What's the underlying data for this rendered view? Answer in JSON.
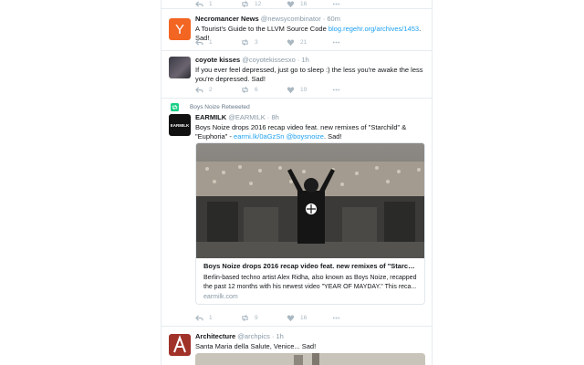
{
  "colors": {
    "accent": "#1da1f2",
    "muted": "#8899a6",
    "border": "#e6ecf0",
    "yc_orange": "#f26522",
    "ember_red": "#a0322a"
  },
  "tweets": [
    {
      "reply_count": "1",
      "retweet_count": "12",
      "like_count": "16"
    },
    {
      "name": "Necromancer News",
      "handle": "@newsycombinator",
      "time": "60m",
      "text": "A Tourist's Guide to the LLVM Source Code",
      "link": "blog.regehr.org/archives/1453",
      "suffix": ". Sad!",
      "avatar_letter": "Y",
      "reply_count": "1",
      "retweet_count": "3",
      "like_count": "21"
    },
    {
      "name": "coyote kisses",
      "handle": "@coyotekissesxo",
      "time": "1h",
      "text": "If you ever feel depressed, just go to sleep :) the less you're awake the less you're depressed. Sad!",
      "reply_count": "2",
      "retweet_count": "6",
      "like_count": "19"
    },
    {
      "retweet_context": "Boys Noize Retweeted",
      "name": "EARMILK",
      "handle": "@EARMILK",
      "time": "8h",
      "text": "Boys Noize drops 2016 recap video feat. new remixes of \"Starchild\" & \"Euphoria\" -",
      "link": "earmi.lk/0aGzSn",
      "mention": "@boysnoize",
      "suffix": ". Sad!",
      "avatar_label": "EARMILK",
      "card": {
        "title": "Boys Noize drops 2016 recap video feat. new remixes of \"Starchild\" & ...",
        "description": "Berlin-based techno artist Alex Ridha, also known as Boys Noize, recapped the past 12 months with his newest video \"YEAR OF MAYDAY.\" This reca...",
        "domain": "earmilk.com"
      },
      "reply_count": "1",
      "retweet_count": "9",
      "like_count": "16"
    },
    {
      "name": "Architecture",
      "handle": "@archpics",
      "time": "1h",
      "text": "Santa Maria della Salute, Venice... Sad!"
    }
  ]
}
